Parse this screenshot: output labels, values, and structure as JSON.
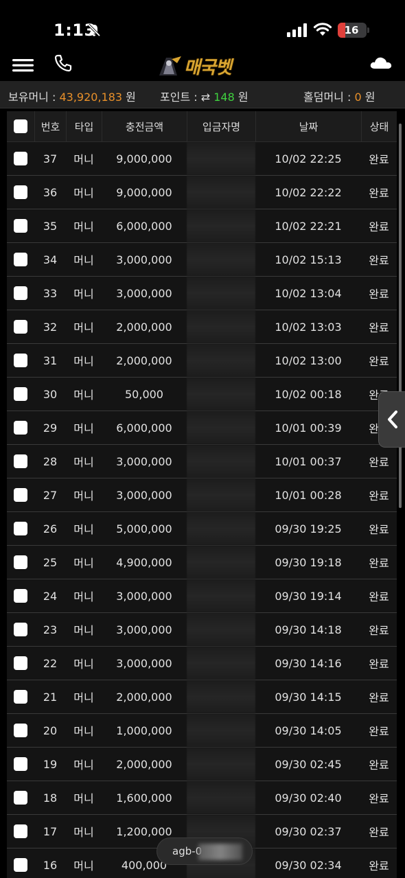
{
  "status_bar": {
    "time": "1:13",
    "battery_level": "16",
    "battery_fraction": 0.16,
    "battery_color": "#e0403b"
  },
  "header": {
    "logo_text": "매국벳"
  },
  "balance": {
    "money_label": "보유머니 : ",
    "money_value": "43,920,183",
    "money_unit": " 원",
    "point_label": "포인트 : ",
    "point_icon": "exchange-icon",
    "point_glyph": "⇄",
    "point_value": "148",
    "point_unit": " 원",
    "hold_label": "홀덤머니 : ",
    "hold_value": "0",
    "hold_unit": " 원",
    "accent_orange": "#e8902a",
    "accent_green": "#3fd13f"
  },
  "table": {
    "headers": {
      "num": "번호",
      "type": "타입",
      "amount": "충전금액",
      "depositor": "입금자명",
      "date": "날짜",
      "status": "상태"
    },
    "rows": [
      {
        "num": "37",
        "type": "머니",
        "amount": "9,000,000",
        "date": "10/02 22:25",
        "status": "완료"
      },
      {
        "num": "36",
        "type": "머니",
        "amount": "9,000,000",
        "date": "10/02 22:22",
        "status": "완료"
      },
      {
        "num": "35",
        "type": "머니",
        "amount": "6,000,000",
        "date": "10/02 22:21",
        "status": "완료"
      },
      {
        "num": "34",
        "type": "머니",
        "amount": "3,000,000",
        "date": "10/02 15:13",
        "status": "완료"
      },
      {
        "num": "33",
        "type": "머니",
        "amount": "3,000,000",
        "date": "10/02 13:04",
        "status": "완료"
      },
      {
        "num": "32",
        "type": "머니",
        "amount": "2,000,000",
        "date": "10/02 13:03",
        "status": "완료"
      },
      {
        "num": "31",
        "type": "머니",
        "amount": "2,000,000",
        "date": "10/02 13:00",
        "status": "완료"
      },
      {
        "num": "30",
        "type": "머니",
        "amount": "50,000",
        "date": "10/02 00:18",
        "status": "완료"
      },
      {
        "num": "29",
        "type": "머니",
        "amount": "6,000,000",
        "date": "10/01 00:39",
        "status": "완료"
      },
      {
        "num": "28",
        "type": "머니",
        "amount": "3,000,000",
        "date": "10/01 00:37",
        "status": "완료"
      },
      {
        "num": "27",
        "type": "머니",
        "amount": "3,000,000",
        "date": "10/01 00:28",
        "status": "완료"
      },
      {
        "num": "26",
        "type": "머니",
        "amount": "5,000,000",
        "date": "09/30 19:25",
        "status": "완료"
      },
      {
        "num": "25",
        "type": "머니",
        "amount": "4,900,000",
        "date": "09/30 19:18",
        "status": "완료"
      },
      {
        "num": "24",
        "type": "머니",
        "amount": "3,000,000",
        "date": "09/30 19:14",
        "status": "완료"
      },
      {
        "num": "23",
        "type": "머니",
        "amount": "3,000,000",
        "date": "09/30 14:18",
        "status": "완료"
      },
      {
        "num": "22",
        "type": "머니",
        "amount": "3,000,000",
        "date": "09/30 14:16",
        "status": "완료"
      },
      {
        "num": "21",
        "type": "머니",
        "amount": "2,000,000",
        "date": "09/30 14:15",
        "status": "완료"
      },
      {
        "num": "20",
        "type": "머니",
        "amount": "1,000,000",
        "date": "09/30 14:05",
        "status": "완료"
      },
      {
        "num": "19",
        "type": "머니",
        "amount": "2,000,000",
        "date": "09/30 02:45",
        "status": "완료"
      },
      {
        "num": "18",
        "type": "머니",
        "amount": "1,600,000",
        "date": "09/30 02:40",
        "status": "완료"
      },
      {
        "num": "17",
        "type": "머니",
        "amount": "1,200,000",
        "date": "09/30 02:37",
        "status": "완료"
      },
      {
        "num": "16",
        "type": "머니",
        "amount": "400,000",
        "date": "09/30 02:34",
        "status": "완료"
      }
    ]
  },
  "url_pill": {
    "text": "agb-0"
  }
}
